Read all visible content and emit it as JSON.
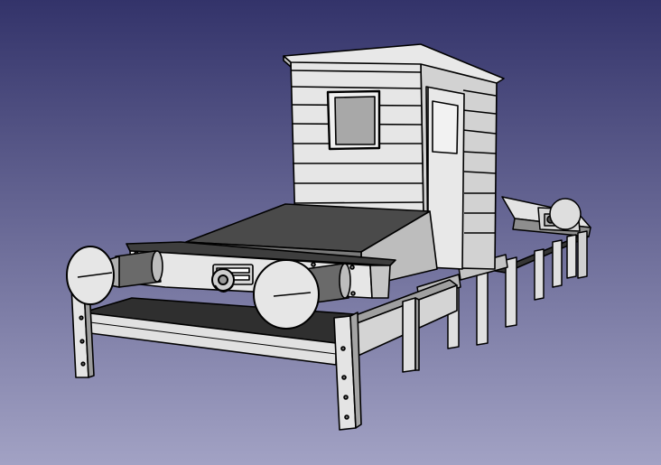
{
  "viewport": {
    "background": {
      "top": "#33336a",
      "bottom": "#a2a2c4"
    },
    "scene": {
      "object": "diesel-shunter-locomotive-model",
      "shading": "flat-with-black-edges",
      "colors": {
        "light_face": "#e3e3e3",
        "mid_face": "#c9c9c9",
        "shadow_face": "#8e8e8e",
        "dark_face": "#4a4a4a",
        "deck": "#363636",
        "edge": "#000000",
        "window": "#a8a8a8"
      }
    }
  }
}
